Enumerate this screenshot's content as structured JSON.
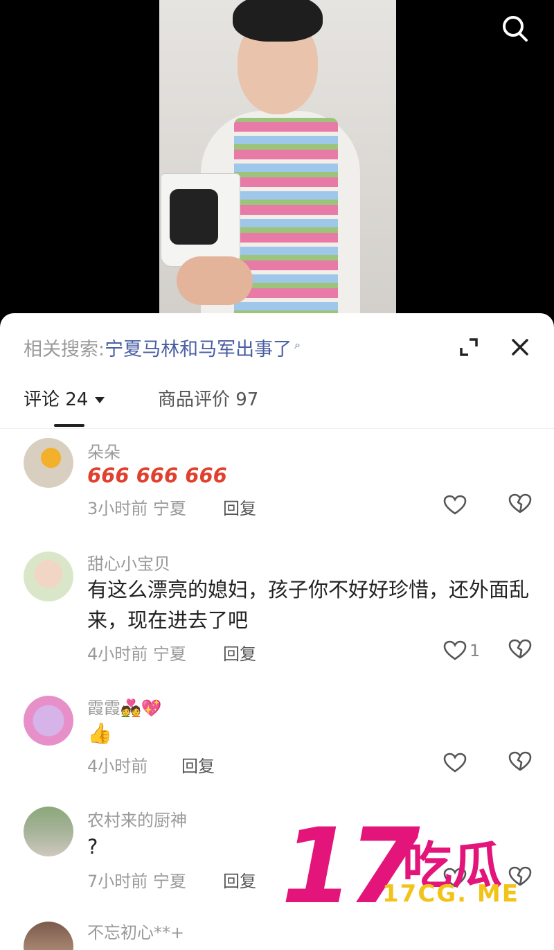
{
  "related_search": {
    "label": "相关搜索:",
    "keyword": "宁夏马林和马军出事了"
  },
  "tabs": {
    "comments_label": "评论 24",
    "reviews_label": "商品评价 97"
  },
  "comments": [
    {
      "user": "朵朵",
      "text": "666 666 666",
      "time": "3小时前",
      "location": "宁夏",
      "reply": "回复",
      "likes": ""
    },
    {
      "user": "甜心小宝贝",
      "text": "有这么漂亮的媳妇，孩子你不好好珍惜，还外面乱来，现在进去了吧",
      "time": "4小时前",
      "location": "宁夏",
      "reply": "回复",
      "likes": "1"
    },
    {
      "user": "霞霞💑💖",
      "text": "👍",
      "time": "4小时前",
      "location": "",
      "reply": "回复",
      "likes": ""
    },
    {
      "user": "农村来的厨神",
      "text": "?",
      "time": "7小时前",
      "location": "宁夏",
      "reply": "回复",
      "likes": ""
    },
    {
      "user": "不忘初心**+",
      "text": "",
      "time": "",
      "location": "",
      "reply": "",
      "likes": ""
    }
  ],
  "watermark": {
    "number": "17",
    "brand": "吃瓜",
    "url": "17CG. ME"
  },
  "icons": {
    "search": "search-icon",
    "expand": "expand-icon",
    "close": "close-icon",
    "like": "heart-icon",
    "dislike": "broken-heart-icon"
  },
  "colors": {
    "accent_link": "#4a5fa3",
    "watermark_pink": "#e3157a",
    "watermark_yellow": "#f2c318"
  }
}
